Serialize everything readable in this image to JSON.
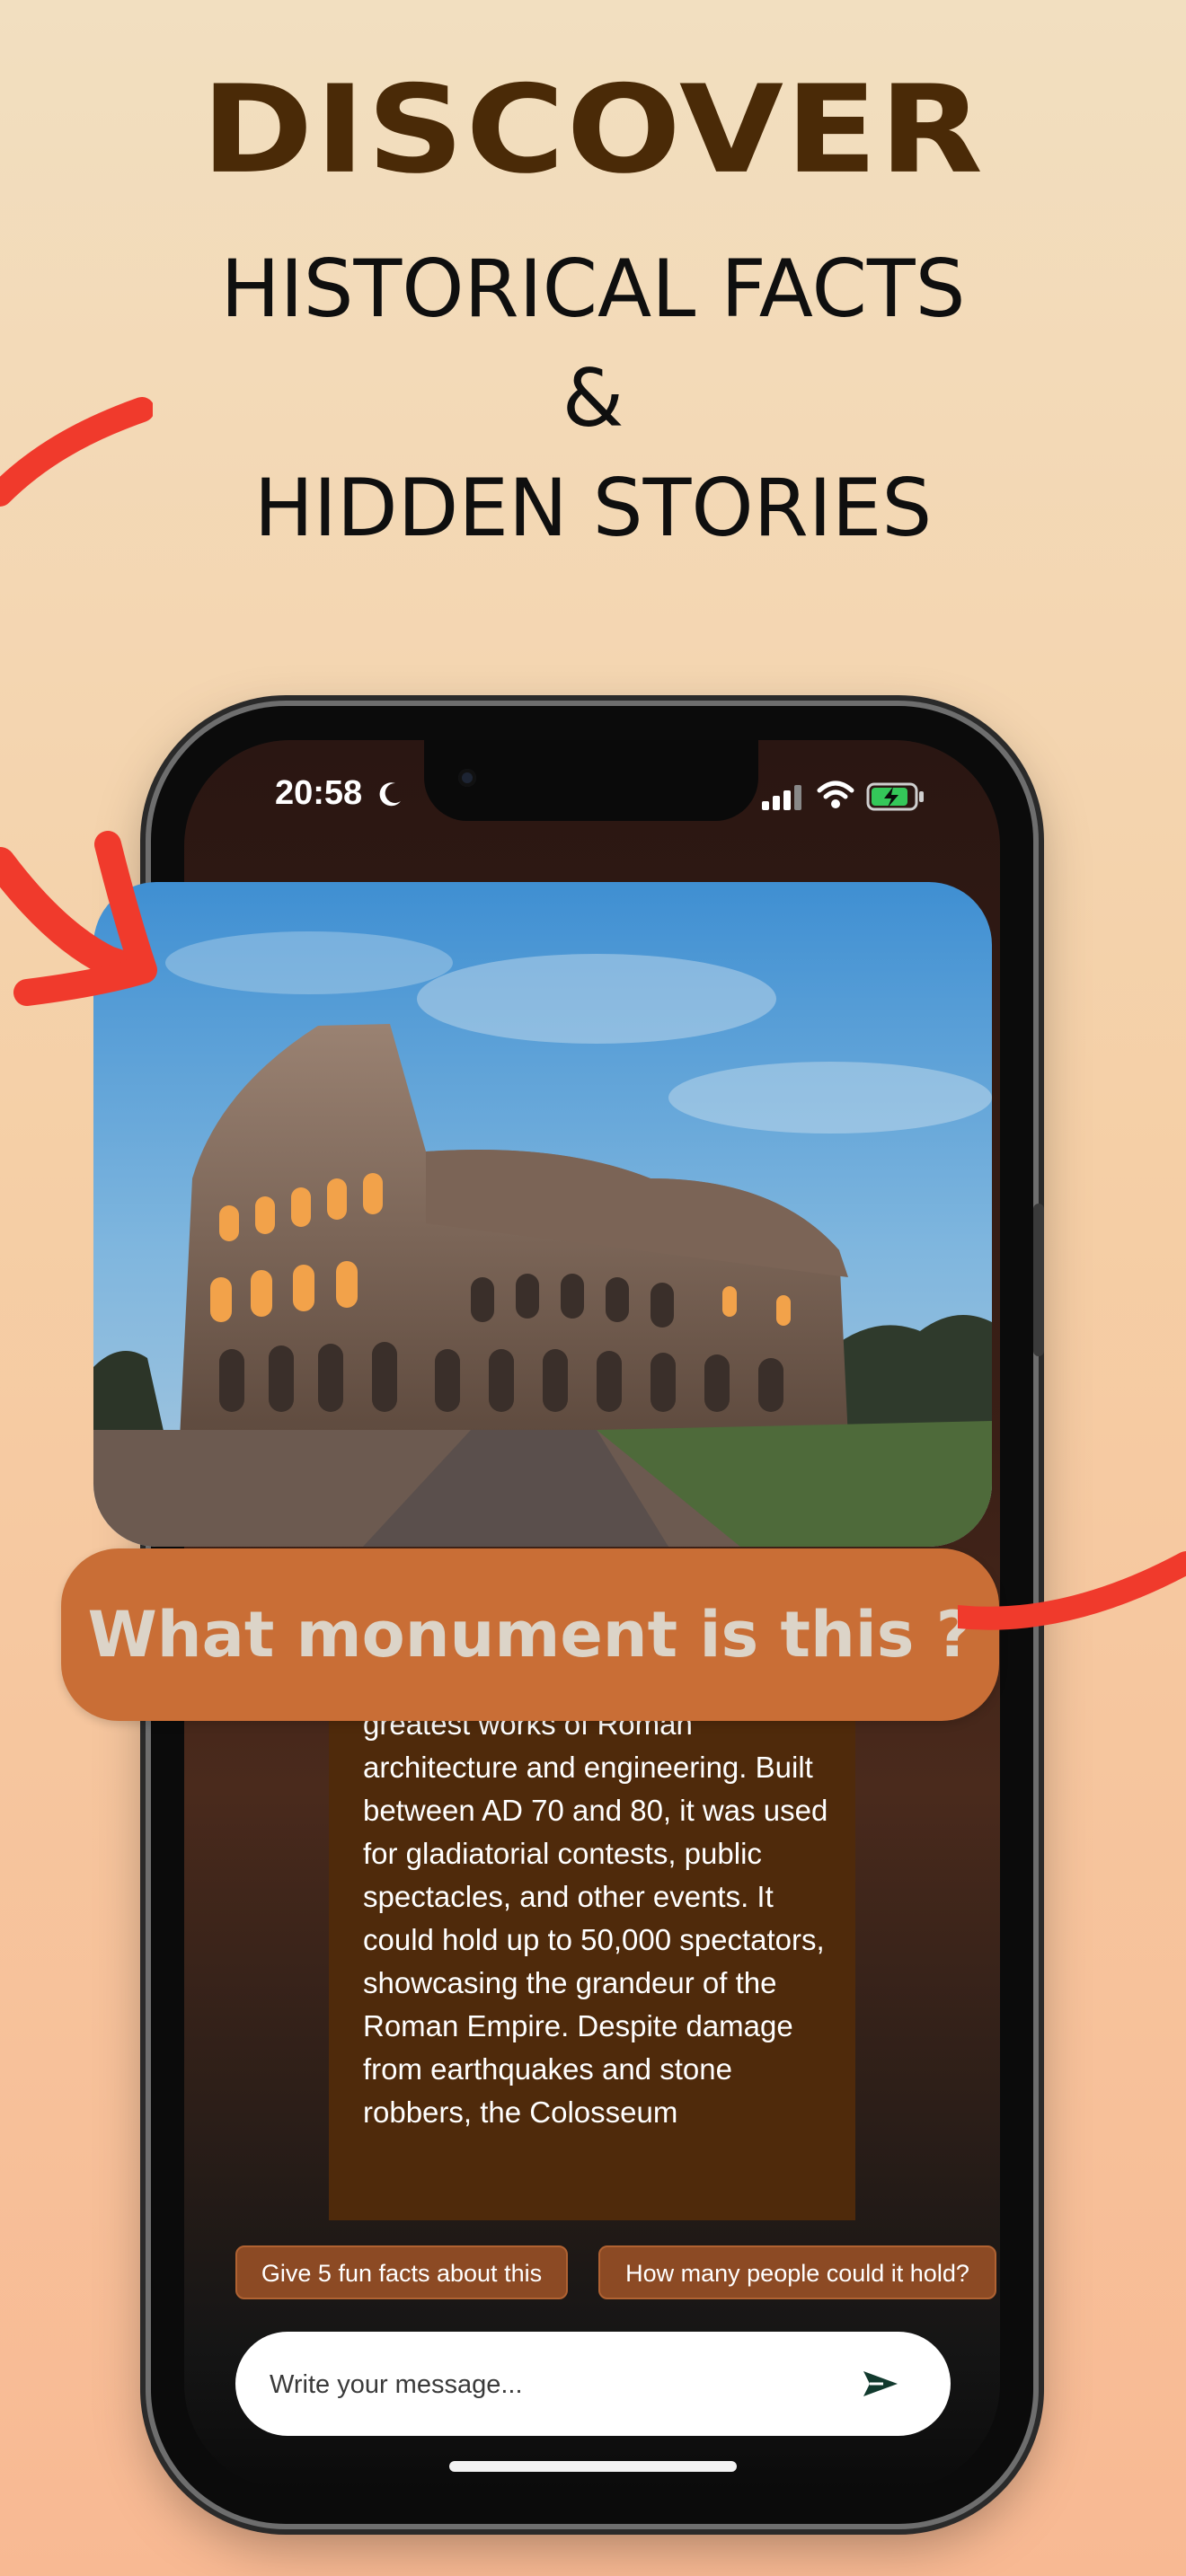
{
  "headline": {
    "title": "DISCOVER",
    "line1": "HISTORICAL FACTS",
    "amp": "&",
    "line2": "HIDDEN STORIES"
  },
  "status_bar": {
    "time": "20:58",
    "icons": [
      "moon-icon",
      "signal-icon",
      "wifi-icon",
      "battery-charging-icon"
    ]
  },
  "question": "What monument is this ?",
  "answer": "amphitheatre and one of the greatest works of Roman architecture and engineering. Built between AD 70 and 80, it was used for gladiatorial contests, public spectacles, and other events. It could hold up to 50,000 spectators, showcasing the grandeur of the Roman Empire. Despite damage from earthquakes and stone robbers, the Colosseum",
  "suggestions": [
    "Give 5 fun facts about this",
    "How many people could it hold?"
  ],
  "composer": {
    "placeholder": "Write your message..."
  },
  "colors": {
    "accent": "#c96e36",
    "arrow": "#f03a2c",
    "headline_dark": "#4a2a07",
    "answer_card": "#4f2a0b"
  }
}
